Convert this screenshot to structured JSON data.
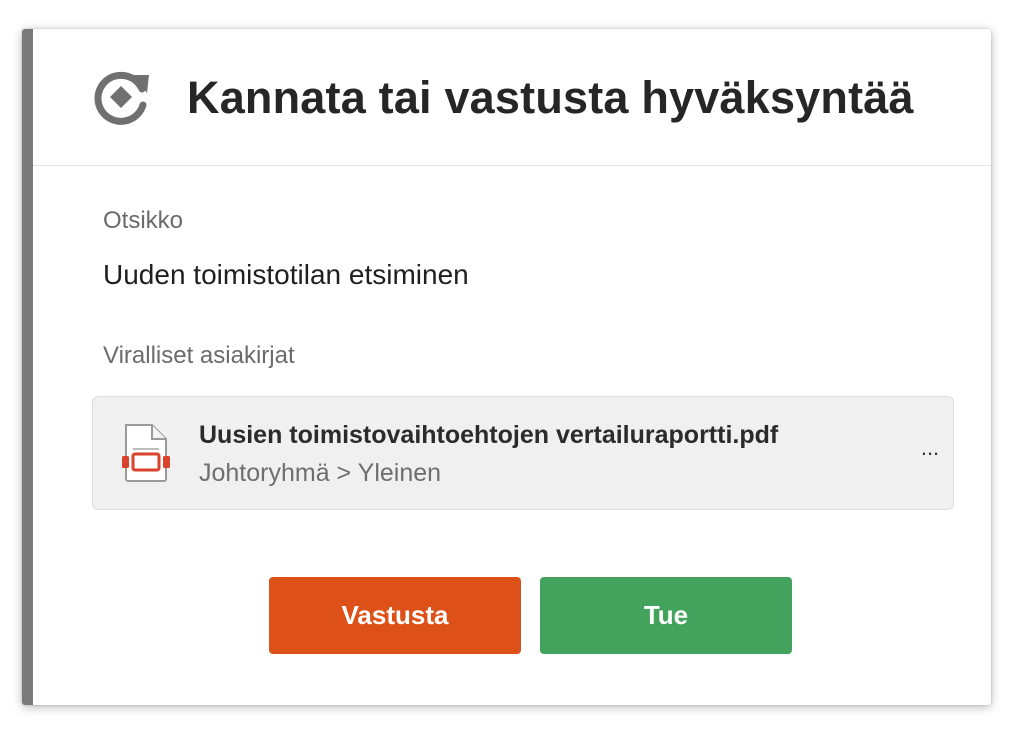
{
  "dialog": {
    "title": "Kannata tai vastusta hyväksyntää",
    "title_icon": "approval-refresh-icon"
  },
  "fields": {
    "title_label": "Otsikko",
    "title_value": "Uuden toimistotilan etsiminen",
    "documents_label": "Viralliset asiakirjat"
  },
  "document": {
    "icon": "pdf-file-icon",
    "name": "Uusien toimistovaihtoehtojen vertailuraportti.pdf",
    "path": "Johtoryhmä > Yleinen",
    "more_label": "..."
  },
  "actions": {
    "reject_label": "Vastusta",
    "approve_label": "Tue"
  },
  "colors": {
    "accent_bar": "#7a7a7a",
    "reject": "#dd5017",
    "approve": "#43a25c",
    "pdf_red": "#d9422b"
  }
}
